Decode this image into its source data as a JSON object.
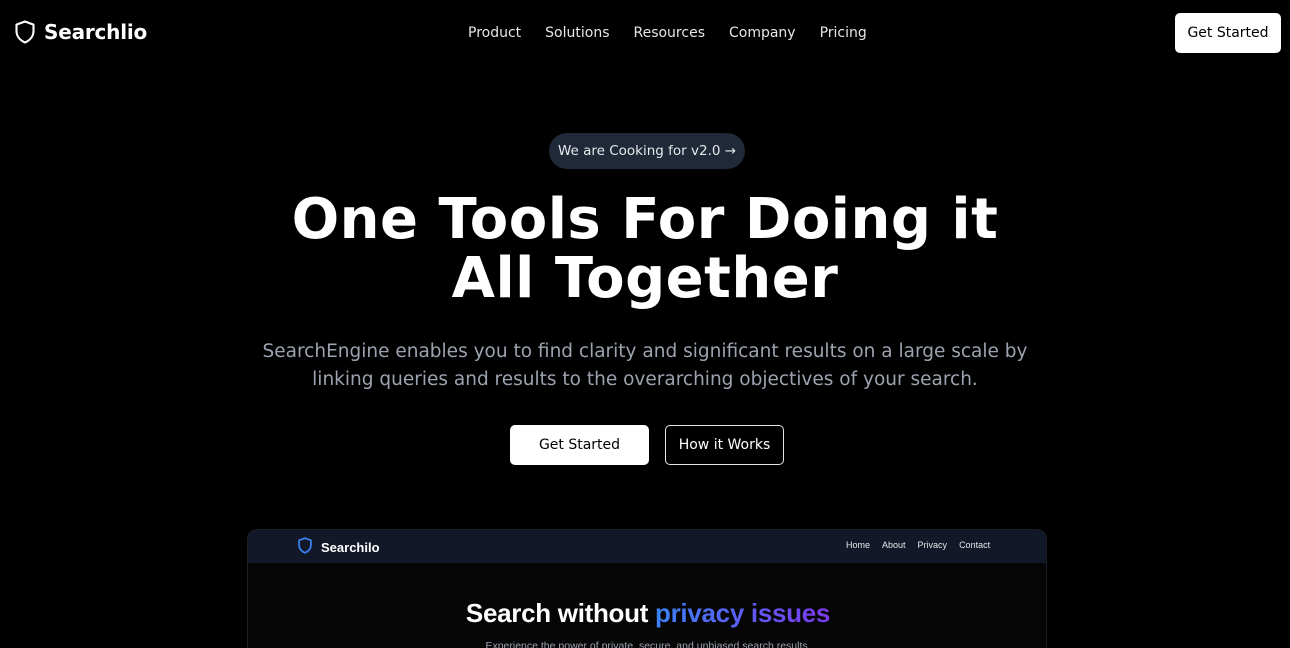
{
  "nav": {
    "brand": "Searchlio",
    "logo_icon": "shield-icon",
    "links": [
      "Product",
      "Solutions",
      "Resources",
      "Company",
      "Pricing"
    ],
    "cta": "Get Started"
  },
  "hero": {
    "badge": "We are Cooking for v2.0 →",
    "title_line1": "One Tools For Doing it",
    "title_line2": "All Together",
    "subtitle_line1": "SearchEngine enables you to find clarity and significant results on a large scale by",
    "subtitle_line2": "linking queries and results to the overarching objectives of your search.",
    "primary_button": "Get Started",
    "secondary_button": "How it Works"
  },
  "preview": {
    "brand": "Searchilo",
    "logo_icon": "shield-icon",
    "links": [
      "Home",
      "About",
      "Privacy",
      "Contact"
    ],
    "title_plain": "Search without ",
    "title_highlight": "privacy issues",
    "subtitle": "Experience the power of private, secure, and unbiased search results.",
    "colors": {
      "accent_start": "#3b82f6",
      "accent_end": "#7c3aed",
      "nav_bg": "#121827"
    }
  },
  "colors": {
    "background": "#000000",
    "badge_bg": "#1f2937",
    "muted_text": "#9ca3af"
  }
}
